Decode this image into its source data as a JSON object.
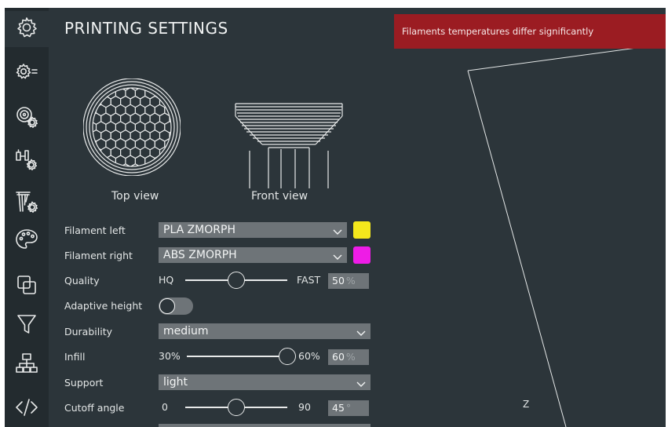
{
  "rail": {
    "items": [
      {
        "icon": "gear-icon"
      },
      {
        "icon": "gear-list-icon"
      },
      {
        "icon": "filament-settings-icon"
      },
      {
        "icon": "extruder-settings-icon"
      },
      {
        "icon": "nozzle-settings-icon"
      },
      {
        "icon": "palette-icon"
      },
      {
        "icon": "layers-icon"
      },
      {
        "icon": "funnel-icon"
      },
      {
        "icon": "hierarchy-icon"
      },
      {
        "icon": "code-icon"
      }
    ]
  },
  "panel": {
    "title": "PRINTING SETTINGS",
    "top_view_label": "Top view",
    "front_view_label": "Front view"
  },
  "filament_left": {
    "label": "Filament left",
    "value": "PLA ZMORPH",
    "color": "#f5e81c"
  },
  "filament_right": {
    "label": "Filament right",
    "value": "ABS ZMORPH",
    "color": "#ee1ce6"
  },
  "quality": {
    "label": "Quality",
    "min_label": "HQ",
    "max_label": "FAST",
    "value": "50",
    "unit": "%",
    "level": 0.5
  },
  "adaptive_height": {
    "label": "Adaptive height",
    "enabled": false
  },
  "durability": {
    "label": "Durability",
    "value": "medium"
  },
  "infill": {
    "label": "Infill",
    "min_label": "30%",
    "max_label": "60%",
    "value": "60",
    "unit": "%",
    "level": 1.0
  },
  "support": {
    "label": "Support",
    "value": "light"
  },
  "cutoff_angle": {
    "label": "Cutoff angle",
    "min_label": "0",
    "max_label": "90",
    "value": "45",
    "unit": "°",
    "level": 0.5
  },
  "viewport": {
    "alert_text": "Filaments temperatures differ significantly",
    "alert_color": "#9b1c22",
    "axis_label": "Z"
  }
}
